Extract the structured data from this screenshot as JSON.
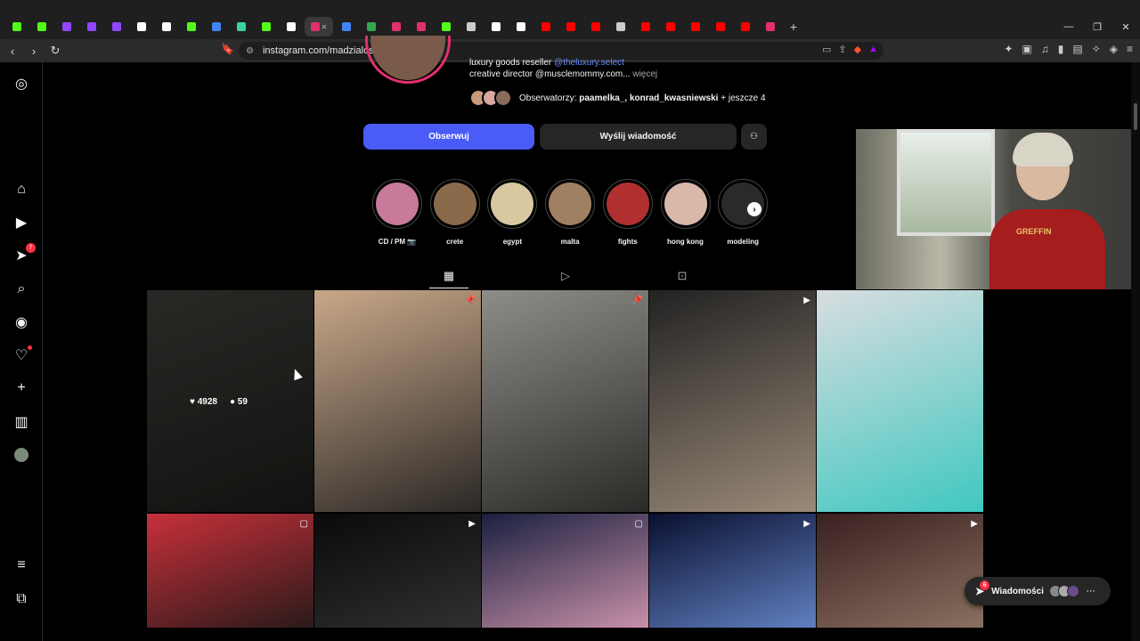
{
  "browser": {
    "tabs": [
      {
        "icon": "kick-icon",
        "color": "#53fc18"
      },
      {
        "icon": "kick-icon",
        "color": "#53fc18"
      },
      {
        "icon": "twitch-icon",
        "color": "#9146ff"
      },
      {
        "icon": "twitch-icon",
        "color": "#9146ff"
      },
      {
        "icon": "twitch-icon",
        "color": "#9146ff"
      },
      {
        "icon": "tiktok-icon",
        "color": "#ffffff"
      },
      {
        "icon": "tiktok-icon",
        "color": "#ffffff"
      },
      {
        "icon": "kick-icon",
        "color": "#53fc18"
      },
      {
        "icon": "google-icon",
        "color": "#4285f4"
      },
      {
        "icon": "tab-icon",
        "color": "#3ad29f"
      },
      {
        "icon": "kick-icon",
        "color": "#53fc18"
      },
      {
        "icon": "tiktok-icon",
        "color": "#ffffff"
      },
      {
        "icon": "instagram-icon",
        "color": "#e1306c",
        "active": true
      },
      {
        "icon": "google-icon",
        "color": "#4285f4"
      },
      {
        "icon": "maps-icon",
        "color": "#34a853"
      },
      {
        "icon": "instagram-icon",
        "color": "#e1306c"
      },
      {
        "icon": "instagram-icon",
        "color": "#e1306c"
      },
      {
        "icon": "kick-icon",
        "color": "#53fc18"
      },
      {
        "icon": "chatgpt-icon",
        "color": "#cccccc"
      },
      {
        "icon": "x-icon",
        "color": "#ffffff"
      },
      {
        "icon": "tiktok-icon",
        "color": "#ffffff"
      },
      {
        "icon": "youtube-icon",
        "color": "#ff0000"
      },
      {
        "icon": "youtube-icon",
        "color": "#ff0000"
      },
      {
        "icon": "youtube-icon",
        "color": "#ff0000"
      },
      {
        "icon": "globe-icon",
        "color": "#cccccc"
      },
      {
        "icon": "youtube-icon",
        "color": "#ff0000"
      },
      {
        "icon": "youtube-icon",
        "color": "#ff0000"
      },
      {
        "icon": "youtube-icon",
        "color": "#ff0000"
      },
      {
        "icon": "youtube-icon",
        "color": "#ff0000"
      },
      {
        "icon": "youtube-icon",
        "color": "#ff0000"
      },
      {
        "icon": "instagram-icon",
        "color": "#e1306c"
      }
    ],
    "url": "instagram.com/madzialoskot/"
  },
  "profile": {
    "bio_line1": "luxury goods reseller ",
    "bio_link": "@theluxury.select",
    "bio_line2": "creative director @musclemommy.com...",
    "bio_more": " więcej",
    "followers_label": "Obserwatorzy: ",
    "followers_names": "paamelka_, konrad_kwasniewski",
    "followers_more": " + jeszcze 4",
    "follow_button": "Obserwuj",
    "message_button": "Wyślij wiadomość"
  },
  "highlights": [
    {
      "label": "CD / PM 📷",
      "color": "#c77a9a"
    },
    {
      "label": "crete",
      "color": "#8a6a4a"
    },
    {
      "label": "egypt",
      "color": "#d8c8a0"
    },
    {
      "label": "malta",
      "color": "#a08060"
    },
    {
      "label": "fights",
      "color": "#b03030"
    },
    {
      "label": "hong kong",
      "color": "#d8b8a8"
    },
    {
      "label": "modeling",
      "color": "#2a2a2a"
    }
  ],
  "posts": [
    {
      "colors": [
        "#3a3a36",
        "#1a1a18"
      ],
      "overlay": "",
      "likes": "4928",
      "comments": "59"
    },
    {
      "colors": [
        "#c9a889",
        "#2b2826"
      ],
      "overlay": "📌"
    },
    {
      "colors": [
        "#8e8d88",
        "#2a2a28"
      ],
      "overlay": "📌"
    },
    {
      "colors": [
        "#222",
        "#9a8a78"
      ],
      "overlay": "▶"
    },
    {
      "colors": [
        "#d8dde0",
        "#40c8c0"
      ],
      "overlay": ""
    },
    {
      "colors": [
        "#c8303a",
        "#2a1a1a"
      ],
      "overlay": "▢"
    },
    {
      "colors": [
        "#0a0a0a",
        "#303030"
      ],
      "overlay": "▶"
    },
    {
      "colors": [
        "#1a2040",
        "#c890a8"
      ],
      "overlay": "▢"
    },
    {
      "colors": [
        "#0a1030",
        "#6080c0"
      ],
      "overlay": "▶"
    },
    {
      "colors": [
        "#3a2020",
        "#8a7060"
      ],
      "overlay": "▶"
    }
  ],
  "webcam": {
    "shirt_text": "GREFFIN"
  },
  "messages": {
    "label": "Wiadomości",
    "badge": "6"
  },
  "sidebar": {
    "notif_badge": "7"
  }
}
